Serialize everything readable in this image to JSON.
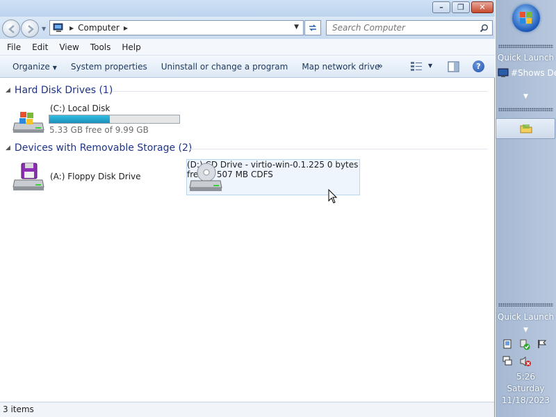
{
  "window": {
    "address_segment": "Computer",
    "search_placeholder": "Search Computer"
  },
  "menu": [
    "File",
    "Edit",
    "View",
    "Tools",
    "Help"
  ],
  "toolbar": {
    "organize": "Organize",
    "system_properties": "System properties",
    "uninstall": "Uninstall or change a program",
    "map_drive": "Map network drive",
    "more": "»"
  },
  "groups": {
    "hard_disks": "Hard Disk Drives (1)",
    "removable": "Devices with Removable Storage (2)"
  },
  "drives": {
    "c": {
      "name": "(C:) Local Disk",
      "free": "5.33 GB free of 9.99 GB",
      "used_fraction": 0.466
    },
    "a": {
      "name": "(A:) Floppy Disk Drive"
    },
    "d": {
      "name": "(D:) CD Drive - virtio-win-0.1.225",
      "free": "0 bytes free of 507 MB",
      "fs": "CDFS"
    }
  },
  "status": {
    "items": "3 items"
  },
  "sidebar": {
    "quick_launch_top": "Quick Launch",
    "quick_launch_item1": "#Shows Des",
    "quick_launch_bottom": "Quick Launch",
    "time": "5:26",
    "day": "Saturday",
    "date": "11/18/2023"
  }
}
